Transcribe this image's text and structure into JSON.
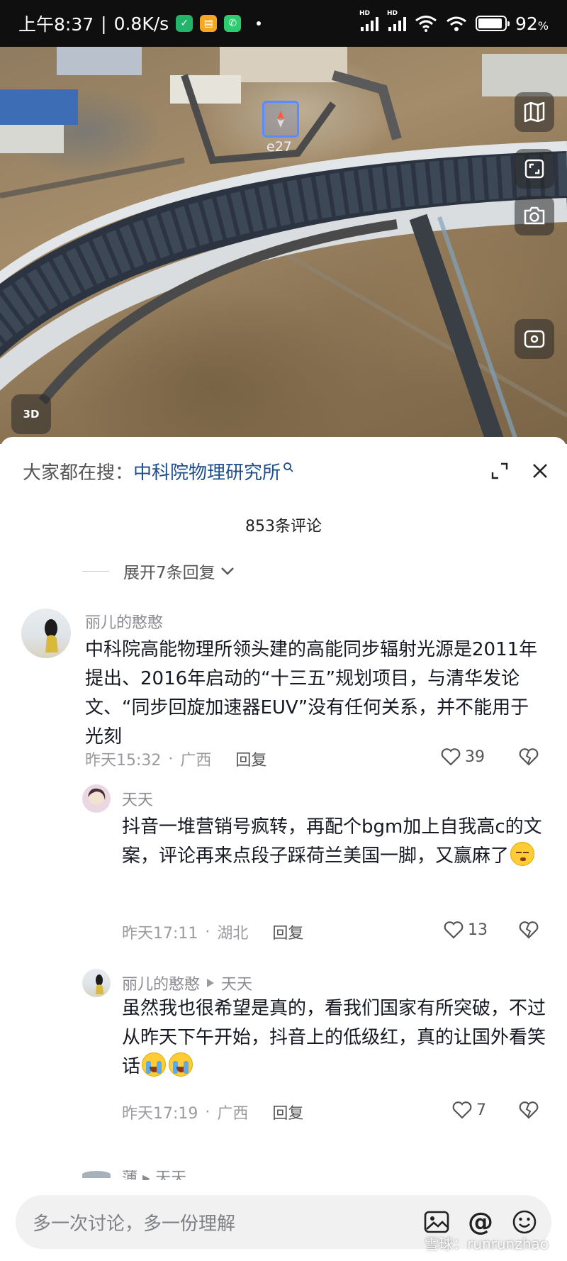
{
  "status_bar": {
    "time": "上午8:37",
    "network_speed": "0.8K/s",
    "battery": "92",
    "battery_unit": "%",
    "signal_label": "HD",
    "battery_level": 0.92
  },
  "map": {
    "compass_label": "e27",
    "view_3d_label": "3D"
  },
  "search_bar": {
    "prefix": "大家都在搜：",
    "term": "中科院物理研究所"
  },
  "comments_count": "853条评论",
  "expand_replies": "展开7条回复",
  "comments": [
    {
      "username": "丽儿的憨憨",
      "text": "中科院高能物理所领头建的高能同步辐射光源是2011年提出、2016年启动的“十三五”规划项目，与清华发论文、“同步回旋加速器EUV”没有任何关系，并不能用于光刻",
      "time": "昨天15:32",
      "location": "广西",
      "reply_label": "回复",
      "likes": "39"
    },
    {
      "username": "天天",
      "text": "抖音一堆营销号疯转，再配个bgm加上自我高c的文案，评论再来点段子踩荷兰美国一脚，又赢麻了",
      "emoji": "sleepy-face",
      "time": "昨天17:11",
      "location": "湖北",
      "reply_label": "回复",
      "likes": "13"
    },
    {
      "username": "丽儿的憨憨",
      "reply_to": "天天",
      "text": "虽然我也很希望是真的，看我们国家有所突破，不过从昨天下午开始，抖音上的低级红，真的让国外看笑话",
      "emoji": "tears-of-joy",
      "time": "昨天17:19",
      "location": "广西",
      "reply_label": "回复",
      "likes": "7"
    }
  ],
  "partial_comment": {
    "username": "薄",
    "reply_to": "天天"
  },
  "input": {
    "placeholder": "多一次讨论，多一份理解",
    "at_symbol": "@"
  },
  "watermark": "雪球：runrunzhao",
  "colors": {
    "search_term": "#1f4e8c",
    "meta_text": "#9a9b9f",
    "username": "#8a8b91"
  }
}
